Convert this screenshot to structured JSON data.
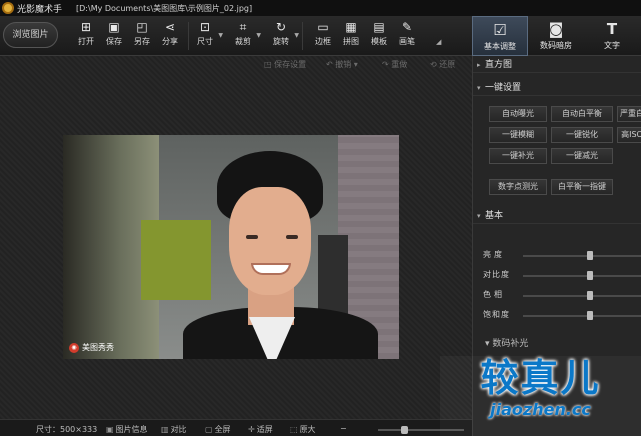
{
  "titlebar": {
    "app_name": "光影魔术手",
    "file_path": "[D:\\My Documents\\美图图库\\示例图片_02.jpg]"
  },
  "toolbar": {
    "open_label": "浏览图片",
    "tools": [
      {
        "label": "打开",
        "icon": "folder-icon"
      },
      {
        "label": "保存",
        "icon": "save-icon"
      },
      {
        "label": "另存",
        "icon": "save-as-icon"
      },
      {
        "label": "分享",
        "icon": "share-icon"
      },
      {
        "label": "尺寸",
        "icon": "resize-icon"
      },
      {
        "label": "裁剪",
        "icon": "crop-icon"
      },
      {
        "label": "旋转",
        "icon": "rotate-icon"
      },
      {
        "label": "边框",
        "icon": "border-icon"
      },
      {
        "label": "拼图",
        "icon": "collage-icon"
      },
      {
        "label": "模板",
        "icon": "template-icon"
      },
      {
        "label": "画笔",
        "icon": "brush-icon"
      }
    ],
    "right_tabs": [
      {
        "label": "基本调整",
        "icon": "adjust-icon",
        "active": true
      },
      {
        "label": "数码暗房",
        "icon": "camera-icon",
        "active": false
      },
      {
        "label": "文字",
        "icon": "text-icon",
        "active": false
      }
    ]
  },
  "canvas_toolbar": {
    "items": [
      "保存设置",
      "撤销",
      "重做",
      "还原"
    ]
  },
  "photo": {
    "watermark": "美图秀秀"
  },
  "statusbar": {
    "size_label": "尺寸：500×333",
    "items": [
      "图片信息",
      "对比",
      "全屏",
      "适屏",
      "原大"
    ],
    "zoom_fraction": 0.3
  },
  "panel": {
    "histogram_title": "直方图",
    "oneclick_title": "一键设置",
    "oneclick_buttons": [
      "自动曝光",
      "自动白平衡",
      "严重白",
      "一键模糊",
      "一键锐化",
      "高ISO",
      "一键补光",
      "一键减光",
      "数字点测光",
      "白平衡一指键"
    ],
    "basic_title": "基本",
    "sliders": [
      {
        "label": "亮度",
        "level": 0.56
      },
      {
        "label": "对比度",
        "level": 0.56
      },
      {
        "label": "色相",
        "level": 0.56
      },
      {
        "label": "饱和度",
        "level": 0.56
      }
    ],
    "fold_label": "数码补光"
  },
  "brand": {
    "main": "较真儿",
    "url": "jiaozhen.cc"
  }
}
